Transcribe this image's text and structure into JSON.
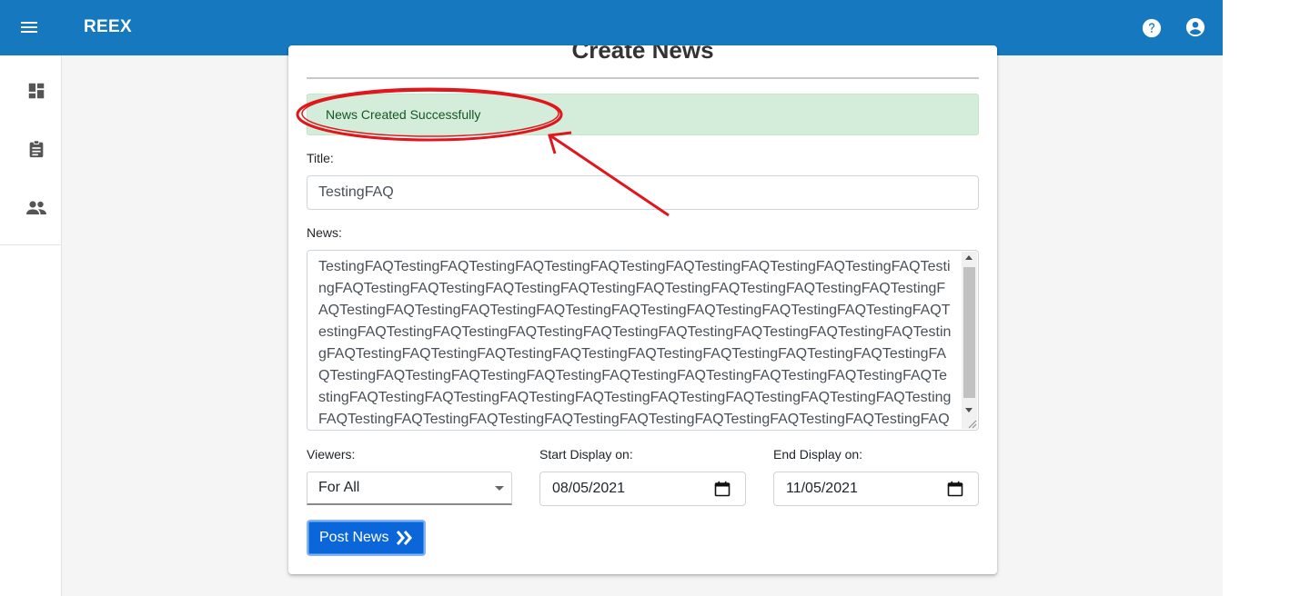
{
  "appbar": {
    "title": "REEX",
    "menu_icon": "menu-icon",
    "help_icon": "help-circle-icon",
    "account_icon": "account-circle-icon",
    "color": "#1679bf"
  },
  "sidebar": {
    "items": [
      {
        "icon": "dashboard-icon"
      },
      {
        "icon": "clipboard-icon"
      },
      {
        "icon": "people-icon"
      }
    ]
  },
  "form": {
    "heading": "Create News",
    "alert": "News Created Successfully",
    "title_label": "Title:",
    "title_value": "TestingFAQ",
    "news_label": "News:",
    "news_value": "TestingFAQTestingFAQTestingFAQTestingFAQTestingFAQTestingFAQTestingFAQTestingFAQTestingFAQTestingFAQTestingFAQTestingFAQTestingFAQTestingFAQTestingFAQTestingFAQTestingFAQTestingFAQTestingFAQTestingFAQTestingFAQTestingFAQTestingFAQTestingFAQTestingFAQTestingFAQTestingFAQTestingFAQTestingFAQTestingFAQTestingFAQTestingFAQTestingFAQTestingFAQTestingFAQTestingFAQTestingFAQTestingFAQTestingFAQTestingFAQTestingFAQTestingFAQTestingFAQTestingFAQTestingFAQTestingFAQTestingFAQTestingFAQTestingFAQTestingFAQTestingFAQTestingFAQTestingFAQTestingFAQTestingFAQTestingFAQTestingFAQTestingFAQTestingFAQTestingFAQTestingFAQTestingFAQTestingFAQTestingFAQTestingFAQTestingFAQTestingFAQTestingFAQTestingFAQTestingFAQTestingFAQTestingFAQ",
    "viewers_label": "Viewers:",
    "viewers_value": "For All",
    "start_label": "Start Display on:",
    "start_value": "08/05/2021",
    "end_label": "End Display on:",
    "end_value": "11/05/2021",
    "submit_label": "Post News",
    "submit_icon": "double-chevron-right-icon",
    "alert_color": "#d4edda",
    "button_color": "#0b66d9"
  },
  "annotation": {
    "color": "#e0161d"
  }
}
